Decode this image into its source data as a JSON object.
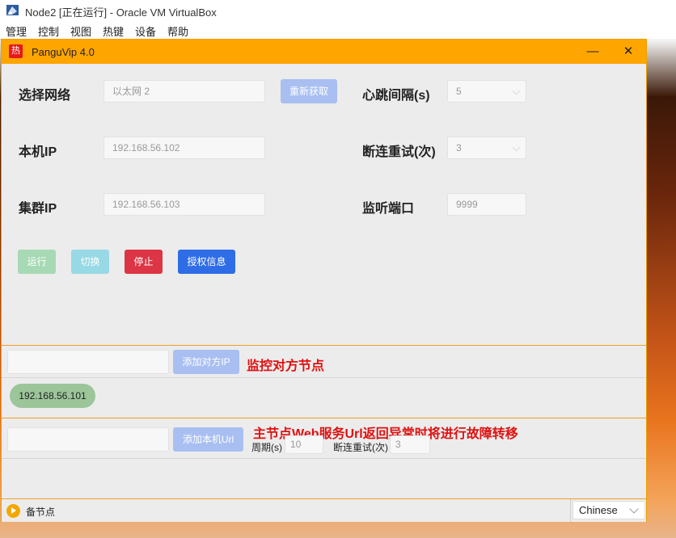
{
  "host": {
    "window_title": "Node2 [正在运行] - Oracle VM VirtualBox",
    "menu": [
      "管理",
      "控制",
      "视图",
      "热键",
      "设备",
      "帮助"
    ]
  },
  "app": {
    "logo_char": "热",
    "title": "PanguVip 4.0",
    "minimize_glyph": "—",
    "close_glyph": "✕"
  },
  "form": {
    "network_label": "选择网络",
    "network_value": "以太网 2",
    "refresh_button": "重新获取",
    "heartbeat_label": "心跳间隔(s)",
    "heartbeat_value": "5",
    "local_ip_label": "本机IP",
    "local_ip_value": "192.168.56.102",
    "retry_label": "断连重试(次)",
    "retry_value": "3",
    "cluster_ip_label": "集群IP",
    "cluster_ip_value": "192.168.56.103",
    "port_label": "监听端口",
    "port_value": "9999"
  },
  "actions": {
    "run": "运行",
    "switch": "切换",
    "stop": "停止",
    "license": "授权信息"
  },
  "peer": {
    "input_value": "",
    "add_button": "添加对方IP",
    "note": "监控对方节点",
    "nodes": [
      "192.168.56.101"
    ]
  },
  "url_monitor": {
    "input_value": "",
    "add_button": "添加本机Url",
    "note": "主节点Web服务Url返回异常时将进行故障转移",
    "period_label": "周期(s)",
    "period_value": "10",
    "retry_label": "断连重试(次)",
    "retry_value": "3"
  },
  "status": {
    "text": "备节点",
    "language": "Chinese"
  },
  "colors": {
    "titlebar": "#ffa500",
    "run": "#a6d9b4",
    "switch": "#97d9e4",
    "stop": "#dc3545",
    "license": "#2f6de6",
    "muted_blue": "#a9bff2",
    "note_red": "#e01010",
    "node_chip": "#9cc59a"
  }
}
